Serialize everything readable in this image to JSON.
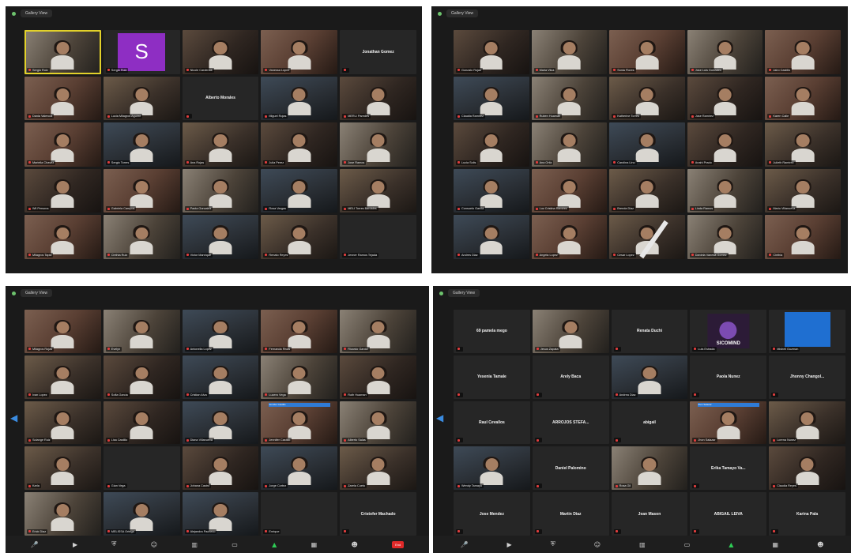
{
  "panels": [
    {
      "topbar": {
        "label": "Gallery View"
      },
      "tiles": [
        {
          "kind": "video",
          "variant": "v3",
          "active": true,
          "name": "Sergio Ruiz"
        },
        {
          "kind": "avatar",
          "letter": "S",
          "name": "Sergio Ruiz"
        },
        {
          "kind": "video",
          "variant": "v1",
          "name": "Nicole Cardenas"
        },
        {
          "kind": "video",
          "variant": "v5",
          "name": "Vanessa Lopez"
        },
        {
          "kind": "nameonly",
          "big": "Jonathan Gomez",
          "name": ""
        },
        {
          "kind": "video",
          "variant": "v5",
          "name": "Dania Valencia"
        },
        {
          "kind": "video",
          "variant": "v2",
          "name": "Lucia Milagros Aguirre"
        },
        {
          "kind": "nameonly",
          "big": "Alberto Morales",
          "name": ""
        },
        {
          "kind": "video",
          "variant": "v4",
          "name": "Miguel Rojas"
        },
        {
          "kind": "video",
          "variant": "v1",
          "name": "MERLI Paredes"
        },
        {
          "kind": "video",
          "variant": "v5",
          "name": "Mariella Chavez"
        },
        {
          "kind": "video",
          "variant": "v4",
          "name": "Sergio Torres"
        },
        {
          "kind": "video",
          "variant": "v2",
          "name": "Ana Rojas"
        },
        {
          "kind": "video",
          "variant": "v1",
          "name": "Julia Perez"
        },
        {
          "kind": "video",
          "variant": "v3",
          "name": "Jose Ramos"
        },
        {
          "kind": "video",
          "variant": "v1",
          "name": "Wil Persona"
        },
        {
          "kind": "video",
          "variant": "v5",
          "name": "Gabriela Campos"
        },
        {
          "kind": "video",
          "variant": "v3",
          "name": "Paola Gonzalez"
        },
        {
          "kind": "video",
          "variant": "v4",
          "name": "Rosa Vargas"
        },
        {
          "kind": "video",
          "variant": "v2",
          "name": "MELI Torres Bardales"
        },
        {
          "kind": "video",
          "variant": "v5",
          "name": "Milagros Tapia"
        },
        {
          "kind": "video",
          "variant": "v3",
          "name": "Cinthia Ruiz"
        },
        {
          "kind": "video",
          "variant": "v4",
          "name": "Victor Manrique"
        },
        {
          "kind": "video",
          "variant": "v2",
          "name": "Renato Reyes"
        },
        {
          "kind": "empty",
          "name": "Jenner Ramos Tejada"
        }
      ]
    },
    {
      "topbar": {
        "label": "Gallery View"
      },
      "tiles": [
        {
          "kind": "video",
          "variant": "v1",
          "name": "Gonzalo Rojas"
        },
        {
          "kind": "video",
          "variant": "v3",
          "name": "Maria Vilca"
        },
        {
          "kind": "video",
          "variant": "v5",
          "name": "Sonia Flores"
        },
        {
          "kind": "video",
          "variant": "v3",
          "name": "Jose Luis Gonzales"
        },
        {
          "kind": "video",
          "variant": "v5",
          "name": "Jairo Castillo"
        },
        {
          "kind": "video",
          "variant": "v4",
          "name": "Claudia Ramirez"
        },
        {
          "kind": "video",
          "variant": "v3",
          "name": "Ruben Huaman"
        },
        {
          "kind": "video",
          "variant": "v2",
          "name": "Katherine Torres"
        },
        {
          "kind": "video",
          "variant": "v1",
          "name": "Jose Ramirez"
        },
        {
          "kind": "video",
          "variant": "v5",
          "name": "Karen Calle"
        },
        {
          "kind": "video",
          "variant": "v1",
          "name": "Lucia Solis"
        },
        {
          "kind": "video",
          "variant": "v3",
          "name": "Ana Ortiz"
        },
        {
          "kind": "video",
          "variant": "v4",
          "name": "Carolina Lino"
        },
        {
          "kind": "video",
          "variant": "v1",
          "name": "Anahi Prado"
        },
        {
          "kind": "video",
          "variant": "v2",
          "name": "Julieth Ramirez"
        },
        {
          "kind": "video",
          "variant": "v4",
          "name": "Consuelo Garcia"
        },
        {
          "kind": "video",
          "variant": "v5",
          "name": "Luz Cristina Ramirez"
        },
        {
          "kind": "video",
          "variant": "v2",
          "name": "Brenda Diaz"
        },
        {
          "kind": "video",
          "variant": "v3",
          "name": "Linda Ramos"
        },
        {
          "kind": "video",
          "variant": "v2",
          "name": "Mario Villanueva"
        },
        {
          "kind": "video",
          "variant": "v4",
          "name": "Andres Diaz"
        },
        {
          "kind": "video",
          "variant": "v5",
          "name": "Angela Lopez"
        },
        {
          "kind": "video",
          "variant": "v2",
          "name": "Cesar Lopez"
        },
        {
          "kind": "video",
          "variant": "v3",
          "name": "Daniela Vanesa Gomez"
        },
        {
          "kind": "video",
          "variant": "v5",
          "name": "Cinthia"
        }
      ]
    },
    {
      "topbar": {
        "label": "Gallery View"
      },
      "tiles": [
        {
          "kind": "video",
          "variant": "v5",
          "name": "Milagros Rojas"
        },
        {
          "kind": "video",
          "variant": "v3",
          "name": "Evelyn"
        },
        {
          "kind": "video",
          "variant": "v4",
          "name": "Antonella Lopez"
        },
        {
          "kind": "video",
          "variant": "v5",
          "name": "Fernanda Rivas"
        },
        {
          "kind": "video",
          "variant": "v3",
          "name": "Ricardo Garcia"
        },
        {
          "kind": "video",
          "variant": "v2",
          "name": "Ivan Lopez"
        },
        {
          "kind": "video",
          "variant": "v1",
          "name": "Sofia Garcia"
        },
        {
          "kind": "video",
          "variant": "v4",
          "name": "Cristian Alva"
        },
        {
          "kind": "video",
          "variant": "v3",
          "name": "Lucero Vega"
        },
        {
          "kind": "video",
          "variant": "v1",
          "name": "Ruth Huaman"
        },
        {
          "kind": "video",
          "variant": "v2",
          "name": "Solange Ruiz"
        },
        {
          "kind": "video",
          "variant": "v1",
          "name": "Lisa Castillo"
        },
        {
          "kind": "video",
          "variant": "v4",
          "name": "Diana Villanueva"
        },
        {
          "kind": "video",
          "variant": "v5",
          "tag": "Jennifer Castillo",
          "name": "Jennifer Castillo"
        },
        {
          "kind": "video",
          "variant": "v3",
          "name": "Alberto Salas"
        },
        {
          "kind": "video",
          "variant": "v2",
          "name": "Karla"
        },
        {
          "kind": "empty",
          "name": "Gian Vega"
        },
        {
          "kind": "video",
          "variant": "v1",
          "name": "Johana Castro"
        },
        {
          "kind": "video",
          "variant": "v4",
          "name": "Jorge Cortez"
        },
        {
          "kind": "video",
          "variant": "v2",
          "name": "Zarela Cueto"
        },
        {
          "kind": "video",
          "variant": "v3",
          "name": "Erick Diaz"
        },
        {
          "kind": "video",
          "variant": "v4",
          "name": "MELISSA Ortega"
        },
        {
          "kind": "video",
          "variant": "v4",
          "name": "Alejandra Pacheco"
        },
        {
          "kind": "empty",
          "name": "Enrique"
        },
        {
          "kind": "nameonly",
          "big": "Cristofer Machado",
          "name": ""
        }
      ]
    },
    {
      "topbar": {
        "label": "Gallery View"
      },
      "tiles": [
        {
          "kind": "nameonly",
          "big": "69 pamela mego",
          "name": ""
        },
        {
          "kind": "video",
          "variant": "v3",
          "name": "Jesus Zapata"
        },
        {
          "kind": "nameonly",
          "big": "Renata Duchi",
          "name": ""
        },
        {
          "kind": "sico",
          "logo": "SICOMIND",
          "name": "Luis Estrada"
        },
        {
          "kind": "blue",
          "name": "Mishell Guzman"
        },
        {
          "kind": "nameonly",
          "big": "Yesenia Tamale",
          "name": ""
        },
        {
          "kind": "nameonly",
          "big": "Arely Baca",
          "name": ""
        },
        {
          "kind": "video",
          "variant": "v4",
          "name": "Andrea Diaz"
        },
        {
          "kind": "nameonly",
          "big": "Paola Nunez",
          "name": ""
        },
        {
          "kind": "nameonly",
          "big": "Jhonny Changol...",
          "name": ""
        },
        {
          "kind": "nameonly",
          "big": "Raul Cevallos",
          "name": ""
        },
        {
          "kind": "nameonly",
          "big": "ARROJOS STEFA...",
          "name": ""
        },
        {
          "kind": "nameonly",
          "big": "abigail",
          "name": ""
        },
        {
          "kind": "video",
          "variant": "v5",
          "tag": "Jhon Salazar",
          "name": "Jhon Salazar"
        },
        {
          "kind": "video",
          "variant": "v2",
          "name": "Lorena Nunez"
        },
        {
          "kind": "video",
          "variant": "v4",
          "name": "Wendy Tamayo"
        },
        {
          "kind": "nameonly",
          "big": "Daniel Palomino",
          "name": ""
        },
        {
          "kind": "video",
          "variant": "v3",
          "name": "Rosa Gil"
        },
        {
          "kind": "nameonly",
          "big": "Erika Tamayo Va...",
          "name": ""
        },
        {
          "kind": "video",
          "variant": "v1",
          "name": "Claudia Reyes"
        },
        {
          "kind": "nameonly",
          "big": "Jose Mendez",
          "name": ""
        },
        {
          "kind": "nameonly",
          "big": "Martin Diaz",
          "name": ""
        },
        {
          "kind": "nameonly",
          "big": "Jean Mason",
          "name": ""
        },
        {
          "kind": "nameonly",
          "big": "ABIGAIL LEIVA",
          "name": ""
        },
        {
          "kind": "nameonly",
          "big": "Karina Pala",
          "name": ""
        }
      ]
    }
  ],
  "toolbar": {
    "end_label": "End"
  }
}
